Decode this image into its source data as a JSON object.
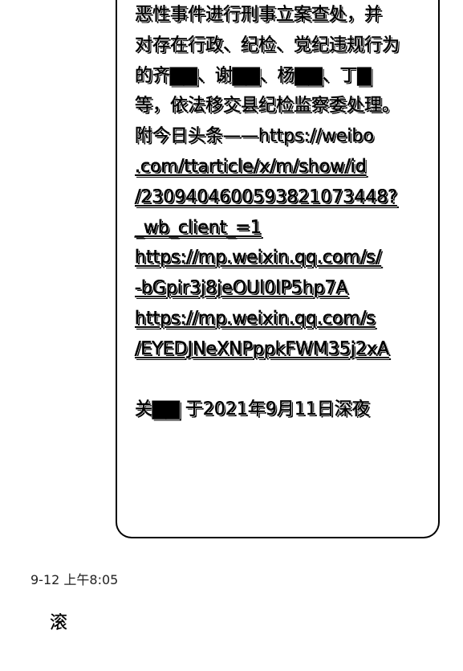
{
  "message": {
    "lines": [
      "恶性事件进行刑事立案查处，并",
      "对存在行政、纪检、党纪违规行为",
      "的齐▇▇、谢▇▇、杨▇▇、丁▇",
      "等，依法移交县纪检监察委处理。",
      "附今日头条——https://weibo",
      ".com/ttarticle/x/m/show/id",
      "/2309404600593821073448?",
      "_wb_client_=1",
      "https://mp.weixin.qq.com/s/",
      "-bGpir3j8jeOUl0lP5hp7A",
      "https://mp.weixin.qq.com/s",
      "/EYEDJNeXNPppkFWM35j2xA"
    ],
    "signature": "关▇▇ 于2021年9月11日深夜"
  },
  "timestamp": "9-12 上午8:05",
  "reply": "滚"
}
